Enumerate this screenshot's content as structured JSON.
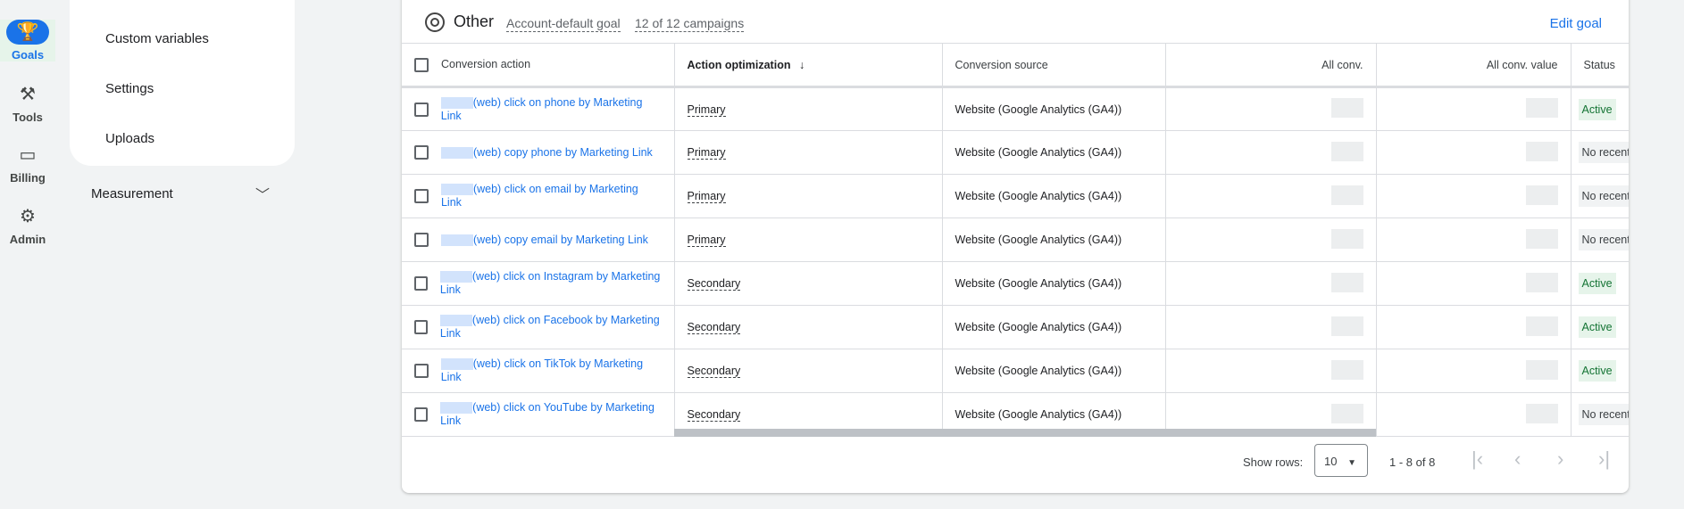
{
  "rail": [
    {
      "label": "Goals",
      "icon": "trophy-icon",
      "active": true
    },
    {
      "label": "Tools",
      "icon": "tools-icon"
    },
    {
      "label": "Billing",
      "icon": "credit-card-icon"
    },
    {
      "label": "Admin",
      "icon": "gear-icon"
    }
  ],
  "menu": {
    "items": [
      "Custom variables",
      "Settings",
      "Uploads"
    ],
    "section": "Measurement"
  },
  "goal": {
    "title": "Other",
    "default": "Account-default goal",
    "campaigns": "12 of 12 campaigns",
    "edit": "Edit goal"
  },
  "table": {
    "headers": [
      "Conversion action",
      "Action optimization",
      "Conversion source",
      "All conv.",
      "All conv. value",
      "Status"
    ],
    "sort_indicator": "↓",
    "rows": [
      {
        "action": "(web) click on phone by Marketing Link",
        "opt": "Primary",
        "source": "Website (Google Analytics (GA4))",
        "status": "Active"
      },
      {
        "action": "(web) copy phone by Marketing Link",
        "opt": "Primary",
        "source": "Website (Google Analytics (GA4))",
        "status": "No recent"
      },
      {
        "action": "(web) click on email by Marketing Link",
        "opt": "Primary",
        "source": "Website (Google Analytics (GA4))",
        "status": "No recent"
      },
      {
        "action": "(web) copy email by Marketing Link",
        "opt": "Primary",
        "source": "Website (Google Analytics (GA4))",
        "status": "No recent"
      },
      {
        "action": "(web) click on Instagram by Marketing Link",
        "opt": "Secondary",
        "source": "Website (Google Analytics (GA4))",
        "status": "Active"
      },
      {
        "action": "(web) click on Facebook by Marketing Link",
        "opt": "Secondary",
        "source": "Website (Google Analytics (GA4))",
        "status": "Active"
      },
      {
        "action": "(web) click on TikTok by Marketing Link",
        "opt": "Secondary",
        "source": "Website (Google Analytics (GA4))",
        "status": "Active"
      },
      {
        "action": "(web) click on YouTube by Marketing Link",
        "opt": "Secondary",
        "source": "Website (Google Analytics (GA4))",
        "status": "No recent"
      }
    ]
  },
  "footer": {
    "show_rows": "Show rows:",
    "rows_value": "10",
    "range": "1 - 8 of 8"
  },
  "colors": {
    "accent": "#1a73e8",
    "active_bg": "#e6f4ea",
    "active_text": "#137333"
  }
}
